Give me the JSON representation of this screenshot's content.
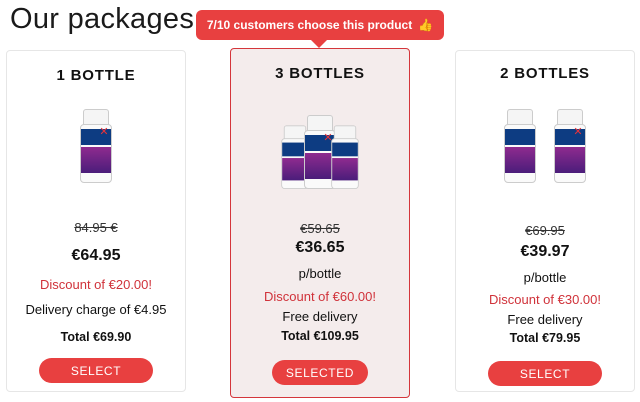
{
  "page": {
    "heading": "Our packages"
  },
  "ribbon": {
    "text": "7/10 customers choose this product",
    "emoji": "👍"
  },
  "packages": [
    {
      "title": "1 BOTTLE",
      "old_price": "84.95 €",
      "price": "€64.95",
      "discount": "Discount of €20.00!",
      "delivery": "Delivery charge of €4.95",
      "total": "Total €69.90",
      "button": "SELECT"
    },
    {
      "title": "3 BOTTLES",
      "old_price": "€59.65",
      "price": "€36.65",
      "unit": "p/bottle",
      "discount": "Discount of €60.00!",
      "delivery": "Free delivery",
      "total": "Total €109.95",
      "button": "SELECTED"
    },
    {
      "title": "2 BOTTLES",
      "old_price": "€69.95",
      "price": "€39.97",
      "unit": "p/bottle",
      "discount": "Discount of €30.00!",
      "delivery": "Free delivery",
      "total": "Total €79.95",
      "button": "SELECT"
    }
  ],
  "colors": {
    "accent": "#e84040",
    "discount": "#d0323a",
    "selected_bg": "#f4ecec"
  }
}
